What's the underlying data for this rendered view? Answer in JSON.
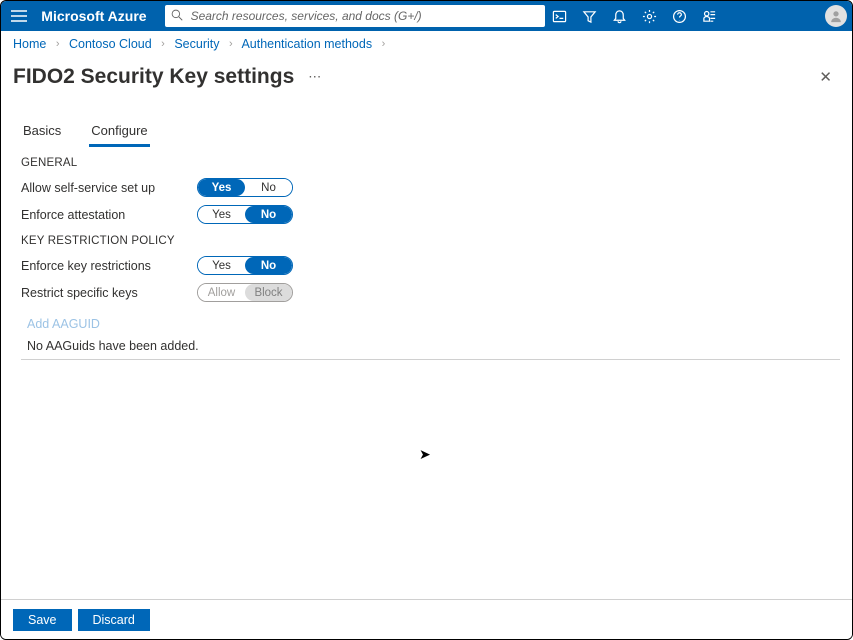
{
  "brand": "Microsoft Azure",
  "search": {
    "placeholder": "Search resources, services, and docs (G+/)"
  },
  "breadcrumb": {
    "items": [
      "Home",
      "Contoso Cloud",
      "Security",
      "Authentication methods"
    ]
  },
  "page": {
    "title": "FIDO2 Security Key settings"
  },
  "tabs": {
    "basics": "Basics",
    "configure": "Configure"
  },
  "sections": {
    "general": "GENERAL",
    "restriction": "KEY RESTRICTION POLICY"
  },
  "rows": {
    "selfservice": "Allow self-service set up",
    "attestation": "Enforce attestation",
    "enforcekeys": "Enforce key restrictions",
    "restrictkeys": "Restrict specific keys"
  },
  "toggles": {
    "yes": "Yes",
    "no": "No",
    "allow": "Allow",
    "block": "Block",
    "selfservice_value": "Yes",
    "attestation_value": "No",
    "enforcekeys_value": "No",
    "restrictkeys_value": "Block",
    "restrictkeys_disabled": true
  },
  "aadguid": {
    "add": "Add AAGUID",
    "empty": "No AAGuids have been added."
  },
  "footer": {
    "save": "Save",
    "discard": "Discard"
  }
}
